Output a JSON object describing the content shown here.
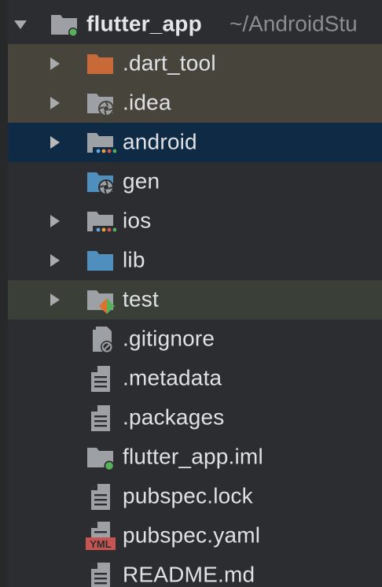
{
  "project": {
    "name": "flutter_app",
    "path": "~/AndroidStu"
  },
  "items": [
    {
      "name": ".dart_tool",
      "icon": "folder-excluded-icon",
      "expandable": true
    },
    {
      "name": ".idea",
      "icon": "folder-idea-icon",
      "expandable": true
    },
    {
      "name": "android",
      "icon": "folder-module-icon",
      "expandable": true
    },
    {
      "name": "gen",
      "icon": "folder-generated-icon",
      "expandable": false
    },
    {
      "name": "ios",
      "icon": "folder-module-icon",
      "expandable": true
    },
    {
      "name": "lib",
      "icon": "folder-source-icon",
      "expandable": true
    },
    {
      "name": "test",
      "icon": "folder-test-icon",
      "expandable": true
    },
    {
      "name": ".gitignore",
      "icon": "ignore-file-icon",
      "expandable": false
    },
    {
      "name": ".metadata",
      "icon": "text-file-icon",
      "expandable": false
    },
    {
      "name": ".packages",
      "icon": "text-file-icon",
      "expandable": false
    },
    {
      "name": "flutter_app.iml",
      "icon": "module-file-icon",
      "expandable": false
    },
    {
      "name": "pubspec.lock",
      "icon": "text-file-icon",
      "expandable": false
    },
    {
      "name": "pubspec.yaml",
      "icon": "yaml-file-icon",
      "expandable": false
    },
    {
      "name": "README.md",
      "icon": "text-file-icon",
      "expandable": false
    }
  ],
  "colors": {
    "background": "#2b2d30",
    "excluded_row": "#47443c",
    "selected_row": "#0f2a45",
    "test_row": "#3a4038",
    "folder_gray": "#9da0a5",
    "folder_blue": "#4f8fbd",
    "folder_orange": "#c8693a",
    "module_dot": "#59b05a",
    "yaml_badge": "#c75450"
  },
  "yaml_badge_text": "YML"
}
